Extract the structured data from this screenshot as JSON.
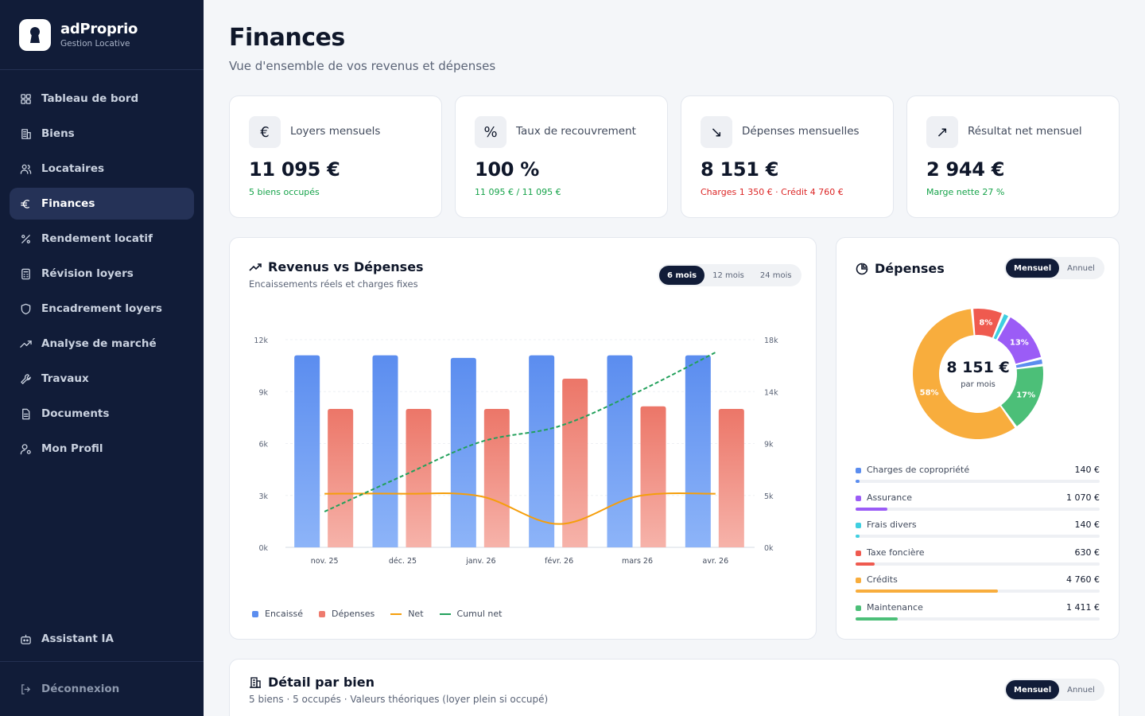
{
  "brand": {
    "name": "adProprio",
    "subtitle": "Gestion Locative"
  },
  "nav": [
    {
      "label": "Tableau de bord",
      "icon": "dashboard-icon",
      "active": false
    },
    {
      "label": "Biens",
      "icon": "building-icon",
      "active": false
    },
    {
      "label": "Locataires",
      "icon": "users-icon",
      "active": false
    },
    {
      "label": "Finances",
      "icon": "euro-icon",
      "active": true
    },
    {
      "label": "Rendement locatif",
      "icon": "percent-icon",
      "active": false
    },
    {
      "label": "Révision loyers",
      "icon": "calculator-icon",
      "active": false
    },
    {
      "label": "Encadrement loyers",
      "icon": "shield-icon",
      "active": false
    },
    {
      "label": "Analyse de marché",
      "icon": "trending-up-icon",
      "active": false
    },
    {
      "label": "Travaux",
      "icon": "wrench-icon",
      "active": false
    },
    {
      "label": "Documents",
      "icon": "file-icon",
      "active": false
    },
    {
      "label": "Mon Profil",
      "icon": "user-settings-icon",
      "active": false
    }
  ],
  "nav_bottom": {
    "assistant": "Assistant IA",
    "logout": "Déconnexion"
  },
  "page": {
    "title": "Finances",
    "subtitle": "Vue d'ensemble de vos revenus et dépenses"
  },
  "kpis": [
    {
      "icon": "euro-icon",
      "glyph": "€",
      "label": "Loyers mensuels",
      "value": "11 095 €",
      "sub": "5 biens occupés",
      "tone": "green"
    },
    {
      "icon": "percent-icon",
      "glyph": "%",
      "label": "Taux de recouvrement",
      "value": "100 %",
      "sub": "11 095 € / 11 095 €",
      "tone": "green"
    },
    {
      "icon": "trending-down-icon",
      "glyph": "↘",
      "label": "Dépenses mensuelles",
      "value": "8 151 €",
      "sub": "Charges 1 350 € · Crédit 4 760 €",
      "tone": "red"
    },
    {
      "icon": "trending-up-icon",
      "glyph": "↗",
      "label": "Résultat net mensuel",
      "value": "2 944 €",
      "sub": "Marge nette 27 %",
      "tone": "green"
    }
  ],
  "revenue_chart": {
    "title": "Revenus vs Dépenses",
    "subtitle": "Encaissements réels et charges fixes",
    "periods": [
      "6 mois",
      "12 mois",
      "24 mois"
    ],
    "active_period": "6 mois",
    "legend": [
      "Encaissé",
      "Dépenses",
      "Net",
      "Cumul net"
    ]
  },
  "chart_data": {
    "type": "bar",
    "categories": [
      "nov. 25",
      "déc. 25",
      "janv. 26",
      "févr. 26",
      "mars 26",
      "avr. 26"
    ],
    "y_left": {
      "ticks": [
        "0k",
        "3k",
        "6k",
        "9k",
        "12k"
      ],
      "ylim": [
        0,
        12000
      ]
    },
    "y_right": {
      "ticks": [
        "0k",
        "5k",
        "9k",
        "14k",
        "18k"
      ],
      "ylim": [
        0,
        18000
      ]
    },
    "grid": true,
    "legend_position": "bottom-left",
    "series": [
      {
        "name": "Encaissé",
        "type": "bar",
        "axis": "left",
        "color": "#5b8def",
        "values": [
          11095,
          11095,
          10950,
          11095,
          11095,
          11095
        ]
      },
      {
        "name": "Dépenses",
        "type": "bar",
        "axis": "left",
        "color": "#ee7b6e",
        "values": [
          8000,
          8000,
          8000,
          9750,
          8150,
          8000
        ]
      },
      {
        "name": "Net",
        "type": "line",
        "axis": "left",
        "color": "#f59e0b",
        "values": [
          3100,
          3100,
          2950,
          1350,
          2950,
          3100
        ]
      },
      {
        "name": "Cumul net",
        "type": "line",
        "axis": "right",
        "style": "dashed",
        "color": "#22a05b",
        "values": [
          3100,
          6200,
          9150,
          10500,
          13450,
          16900
        ]
      }
    ]
  },
  "expenses": {
    "title": "Dépenses",
    "toggle": [
      "Mensuel",
      "Annuel"
    ],
    "active": "Mensuel",
    "total": "8 151 €",
    "total_label": "par mois",
    "items": [
      {
        "label": "Charges de copropriété",
        "value": "140 €",
        "amount": 140,
        "color": "#5b8def"
      },
      {
        "label": "Assurance",
        "value": "1 070 €",
        "amount": 1070,
        "color": "#9b5cf6"
      },
      {
        "label": "Frais divers",
        "value": "140 €",
        "amount": 140,
        "color": "#3fcfe0"
      },
      {
        "label": "Taxe foncière",
        "value": "630 €",
        "amount": 630,
        "color": "#ef5a4f"
      },
      {
        "label": "Crédits",
        "value": "4 760 €",
        "amount": 4760,
        "color": "#f8ad3d"
      },
      {
        "label": "Maintenance",
        "value": "1 411 €",
        "amount": 1411,
        "color": "#4cbf78"
      }
    ],
    "donut_labels": [
      {
        "item": "Taxe foncière",
        "text": "8%"
      },
      {
        "item": "Assurance",
        "text": "13%"
      },
      {
        "item": "Maintenance",
        "text": "17%"
      },
      {
        "item": "Crédits",
        "text": "58%"
      }
    ]
  },
  "detail": {
    "title": "Détail par bien",
    "subtitle": "5 biens · 5 occupés · Valeurs théoriques (loyer plein si occupé)",
    "toggle": [
      "Mensuel",
      "Annuel"
    ],
    "active": "Mensuel"
  }
}
